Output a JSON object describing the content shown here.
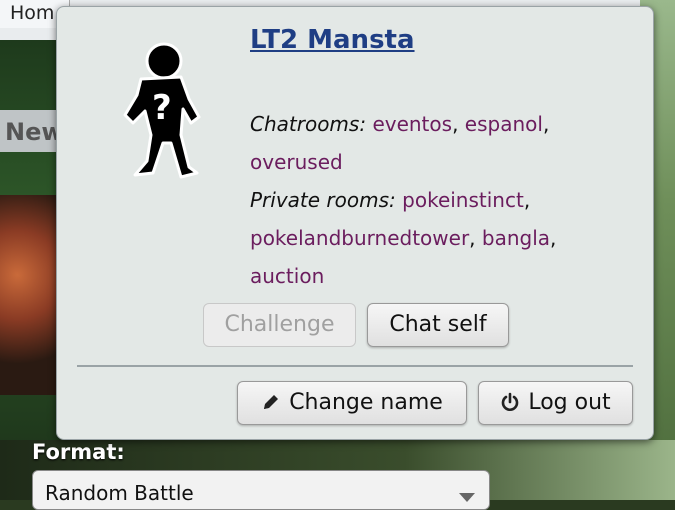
{
  "background": {
    "home_tab": "Hom",
    "news_heading": "New",
    "format_label": "Format:",
    "format_value": "Random Battle"
  },
  "popup": {
    "username": "LT2 Mansta",
    "chatrooms_label": "Chatrooms:",
    "chatrooms": [
      "eventos",
      "espanol",
      "overused"
    ],
    "private_label": "Private rooms:",
    "private_rooms": [
      "pokeinstinct",
      "pokelandburnedtower",
      "bangla",
      "auction"
    ],
    "buttons": {
      "challenge": "Challenge",
      "chat_self": "Chat self",
      "change_name": "Change name",
      "log_out": "Log out"
    },
    "icons": {
      "change_name": "pencil-icon",
      "log_out": "power-icon"
    },
    "colors": {
      "username": "#1f3e84",
      "room_link": "#6b1d5e"
    }
  }
}
